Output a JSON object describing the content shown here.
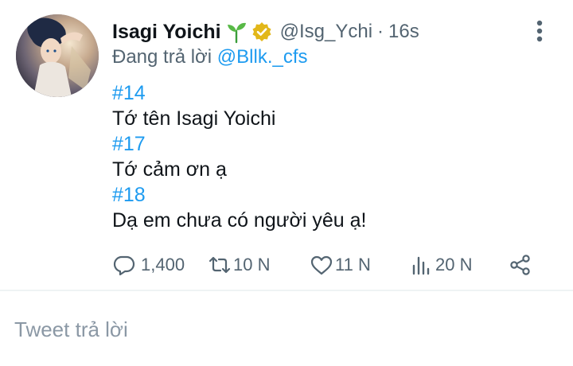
{
  "tweet": {
    "display_name": "Isagi Yoichi",
    "handle": "@Isg_Ychi",
    "separator": "·",
    "time": "16s",
    "replying_prefix": "Đang trả lời",
    "replying_to": "@Bllk._cfs",
    "body": [
      {
        "kind": "hashtag",
        "text": "#14"
      },
      {
        "kind": "text",
        "text": "Tớ tên Isagi Yoichi"
      },
      {
        "kind": "hashtag",
        "text": "#17"
      },
      {
        "kind": "text",
        "text": "Tớ cảm ơn ạ"
      },
      {
        "kind": "hashtag",
        "text": "#18"
      },
      {
        "kind": "text",
        "text": "Dạ em chưa có người yêu ạ!"
      }
    ],
    "actions": {
      "replies": "1,400",
      "retweets": "10 N",
      "likes": "11 N",
      "views": "20 N"
    }
  },
  "reply_box": {
    "placeholder": "Tweet trả lời"
  },
  "colors": {
    "link": "#1d9bf0",
    "secondary_text": "#536471",
    "verified_badge": "#e2b719",
    "sprout": "#3a9d3a"
  },
  "icons": [
    "sprout-icon",
    "verified-icon",
    "more-vertical-icon",
    "reply-icon",
    "retweet-icon",
    "like-icon",
    "views-icon",
    "share-icon"
  ]
}
